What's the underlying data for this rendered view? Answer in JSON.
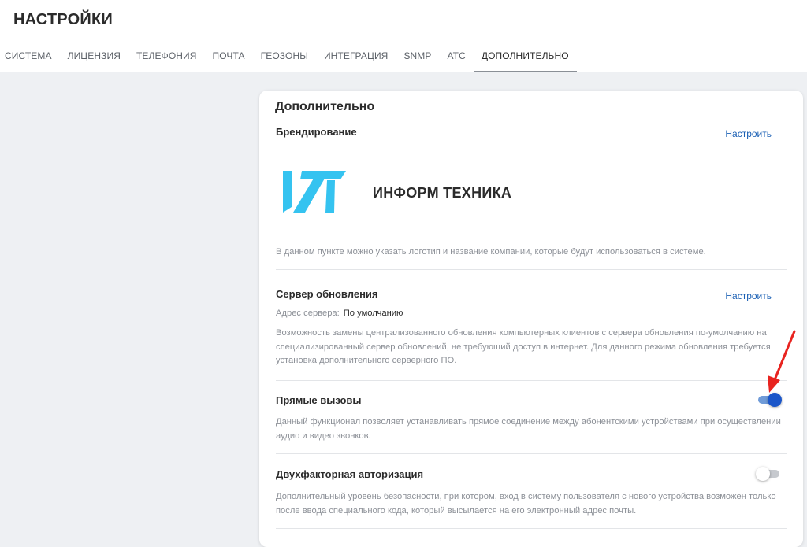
{
  "header": {
    "title": "НАСТРОЙКИ",
    "tabs": [
      {
        "label": "СИСТЕМА"
      },
      {
        "label": "ЛИЦЕНЗИЯ"
      },
      {
        "label": "ТЕЛЕФОНИЯ"
      },
      {
        "label": "ПОЧТА"
      },
      {
        "label": "ГЕОЗОНЫ"
      },
      {
        "label": "ИНТЕГРАЦИЯ"
      },
      {
        "label": "SNMP"
      },
      {
        "label": "АТС"
      },
      {
        "label": "ДОПОЛНИТЕЛЬНО"
      }
    ],
    "active_tab": "ДОПОЛНИТЕЛЬНО"
  },
  "card": {
    "title": "Дополнительно",
    "branding": {
      "title": "Брендирование",
      "configure_label": "Настроить",
      "company_name": "ИНФОРМ ТЕХНИКА",
      "logo_color": "#35c3f0",
      "description": "В данном пункте можно указать логотип и название компании, которые будут использоваться в системе."
    },
    "update_server": {
      "title": "Сервер обновления",
      "configure_label": "Настроить",
      "address_label": "Адрес сервера:",
      "address_value": "По умолчанию",
      "description": "Возможность замены централизованного обновления компьютерных клиентов с сервера обновления по-умолчанию на специализированный сервер обновлений, не требующий доступ в интернет. Для данного режима обновления требуется установка дополнительного серверного ПО."
    },
    "direct_calls": {
      "title": "Прямые вызовы",
      "enabled": true,
      "description": "Данный функционал позволяет устанавливать прямое соединение между абонентскими устройствами при осуществлении аудио и видео звонков."
    },
    "two_factor": {
      "title": "Двухфакторная авторизация",
      "enabled": false,
      "description": "Дополнительный уровень безопасности, при котором, вход в систему пользователя с нового устройства возможен только после ввода специального кода, который высылается на его электронный адрес почты."
    }
  },
  "colors": {
    "accent": "#1b56c9",
    "link": "#1a5fb4",
    "annotation_arrow": "#e8231f"
  }
}
